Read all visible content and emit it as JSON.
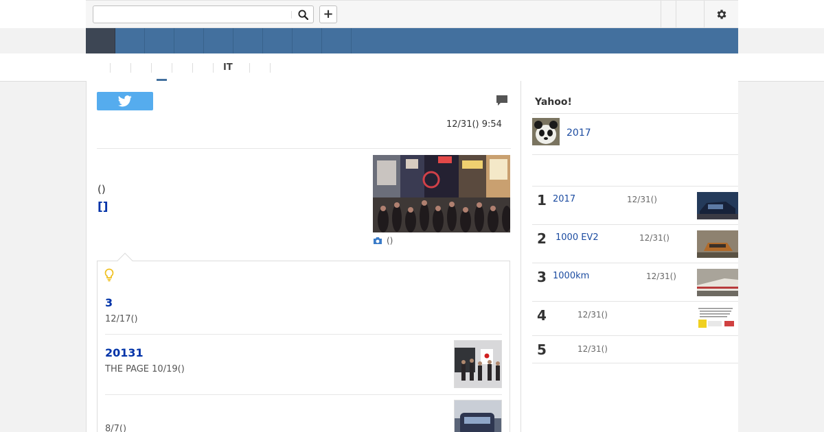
{
  "search": {
    "value": "",
    "placeholder": ""
  },
  "header": {
    "add_label": "+"
  },
  "subnav": {
    "active_category": "IT"
  },
  "article": {
    "timestamp": "12/31() 9:54",
    "publisher": "()",
    "link_text": "[]",
    "photo_caption": "()"
  },
  "related": {
    "items": [
      {
        "title": "3",
        "meta": " 12/17()"
      },
      {
        "title": "20131",
        "meta": "THE PAGE 10/19()"
      },
      {
        "title": "",
        "meta": " 8/7()"
      }
    ]
  },
  "sidebar": {
    "heading": "Yahoo!",
    "feature_link": "2017",
    "ranking": [
      {
        "rank": "1",
        "title": "2017",
        "date": "12/31()"
      },
      {
        "rank": "2",
        "title": "1000 EV2",
        "date": "12/31()"
      },
      {
        "rank": "3",
        "title": "1000km",
        "date": "12/31()"
      },
      {
        "rank": "4",
        "title": "",
        "date": "12/31()"
      },
      {
        "rank": "5",
        "title": "",
        "date": "12/31()"
      }
    ]
  },
  "colors": {
    "nav_blue": "#43709e",
    "nav_active": "#3d4654",
    "link_blue": "#0033a8",
    "twitter_blue": "#55acee",
    "bulb_yellow": "#f0c020"
  },
  "icons": [
    "search-icon",
    "plus-icon",
    "gear-icon",
    "twitter-icon",
    "comment-icon",
    "camera-icon",
    "bulb-icon"
  ]
}
